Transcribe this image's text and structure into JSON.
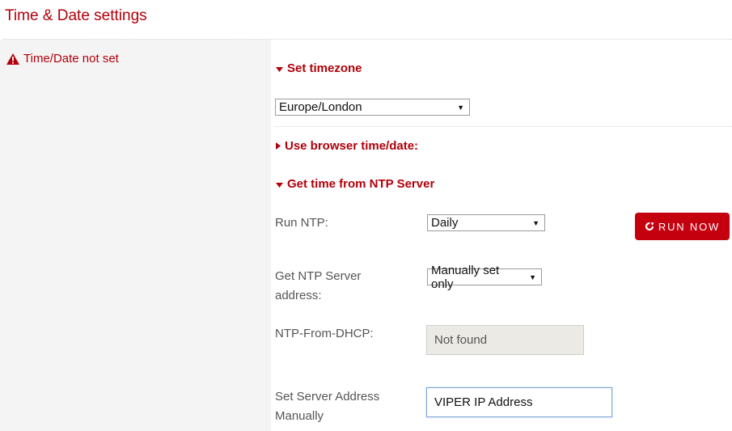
{
  "page": {
    "title": "Time & Date settings"
  },
  "status": {
    "warning_text": "Time/Date not set",
    "color": "#b2000b"
  },
  "sections": {
    "timezone": {
      "label": "Set timezone",
      "expanded": true,
      "selected": "Europe/London"
    },
    "browser_time": {
      "label": "Use browser time/date:",
      "expanded": false
    },
    "ntp": {
      "label": "Get time from NTP Server",
      "expanded": true,
      "run_ntp": {
        "label": "Run NTP:",
        "selected": "Daily"
      },
      "run_now_button": "RUN NOW",
      "server_address": {
        "label_line1": "Get NTP Server",
        "label_line2": "address:",
        "selected": "Manually set only"
      },
      "ntp_from_dhcp": {
        "label": "NTP-From-DHCP:",
        "value": "Not found"
      },
      "manual_address": {
        "label_line1": "Set Server Address",
        "label_line2": "Manually",
        "value": "VIPER IP Address"
      }
    }
  },
  "colors": {
    "accent": "#b2000b",
    "button": "#c4000f",
    "left_panel": "#f4f4f4"
  }
}
